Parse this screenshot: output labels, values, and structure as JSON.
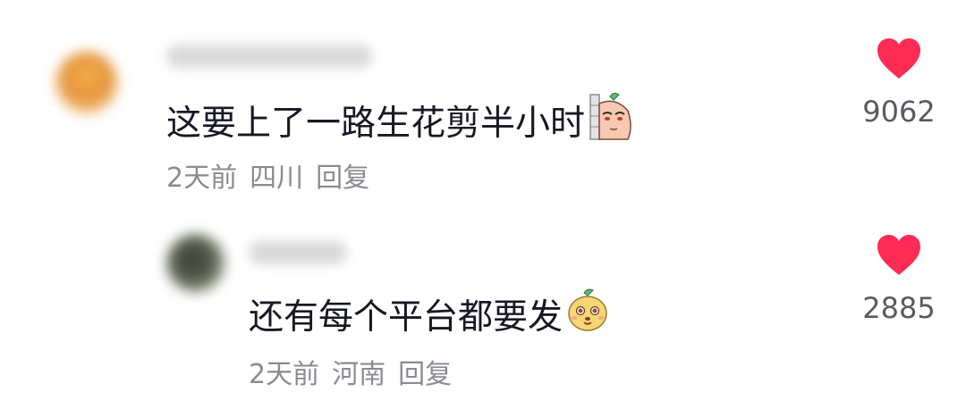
{
  "colors": {
    "like_heart": "#fe2c55",
    "text_primary": "#161823",
    "text_meta": "#8a8b91"
  },
  "comments": [
    {
      "text": "这要上了一路生花剪半小时",
      "emoji": "peeking-peach-sticker",
      "time": "2天前",
      "location": "四川",
      "reply_label": "回复",
      "likes": "9062",
      "liked": true
    },
    {
      "text": "还有每个平台都要发",
      "emoji": "smiling-mango-sticker",
      "time": "2天前",
      "location": "河南",
      "reply_label": "回复",
      "likes": "2885",
      "liked": true
    }
  ]
}
